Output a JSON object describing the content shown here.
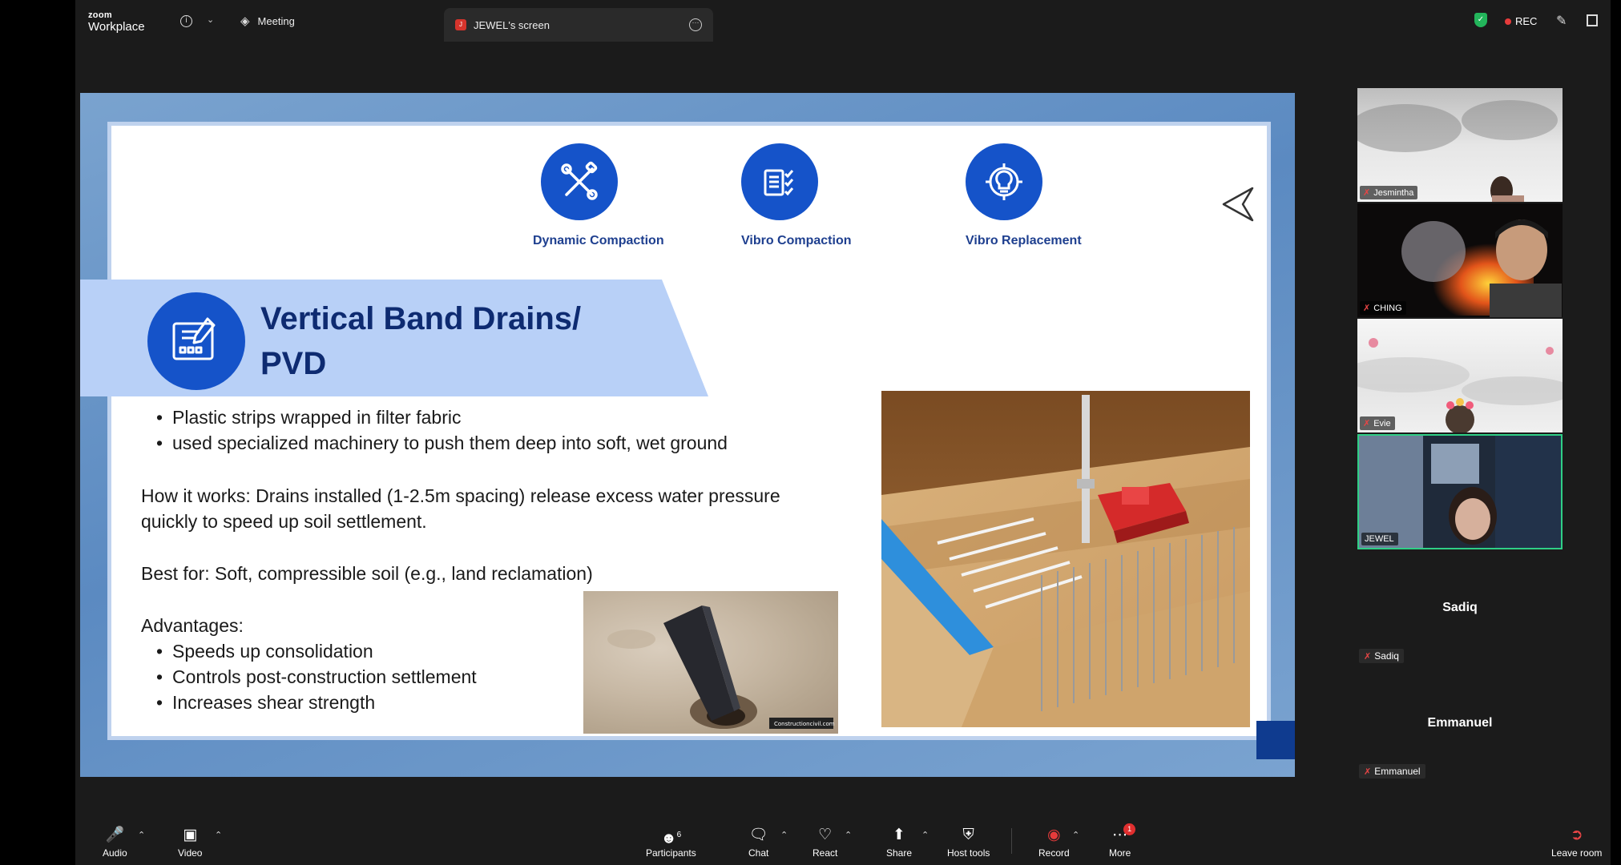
{
  "app": {
    "brand_small": "zoom",
    "brand_name": "Workplace"
  },
  "tabs": [
    {
      "label": "Meeting"
    },
    {
      "label": "JEWEL's screen",
      "initial": "J"
    }
  ],
  "top_right": {
    "rec_label": "REC"
  },
  "slide": {
    "methods": [
      {
        "label": "Dynamic Compaction",
        "icon": "wrench-screwdriver-icon"
      },
      {
        "label": "Vibro Compaction",
        "icon": "checklist-icon"
      },
      {
        "label": "Vibro Replacement",
        "icon": "gear-bulb-icon"
      }
    ],
    "title_line1": "Vertical Band Drains/",
    "title_line2": "PVD",
    "bullets1": [
      "Plastic strips wrapped in filter fabric",
      "used specialized machinery to push them deep into soft, wet ground"
    ],
    "how_line1": "How it works: Drains installed (1-2.5m spacing) release excess water pressure",
    "how_line2": "quickly to speed up soil settlement.",
    "best_for": "Best for: Soft, compressible soil (e.g.,  land reclamation)",
    "advantages_heading": "Advantages:",
    "advantages": [
      "Speeds up consolidation",
      "Controls post-construction settlement",
      "Increases shear strength"
    ],
    "photo_watermark": "Constructioncivil.com"
  },
  "participants": [
    {
      "name": "Jesmintha",
      "muted": true
    },
    {
      "name": "CHING",
      "muted": true
    },
    {
      "name": "Evie",
      "muted": true
    },
    {
      "name": "JEWEL",
      "muted": false,
      "active": true
    },
    {
      "name": "Sadiq",
      "muted": true
    },
    {
      "name": "Emmanuel",
      "muted": true
    }
  ],
  "toolbar": {
    "audio": "Audio",
    "video": "Video",
    "participants": "Participants",
    "participants_count": "6",
    "chat": "Chat",
    "react": "React",
    "share": "Share",
    "host_tools": "Host tools",
    "record": "Record",
    "more": "More",
    "more_badge": "1",
    "leave": "Leave room"
  },
  "colors": {
    "accent_blue": "#1553c9",
    "title_blue": "#0e2b71",
    "active_border": "#2fcf86",
    "rec_red": "#e63b3b"
  }
}
